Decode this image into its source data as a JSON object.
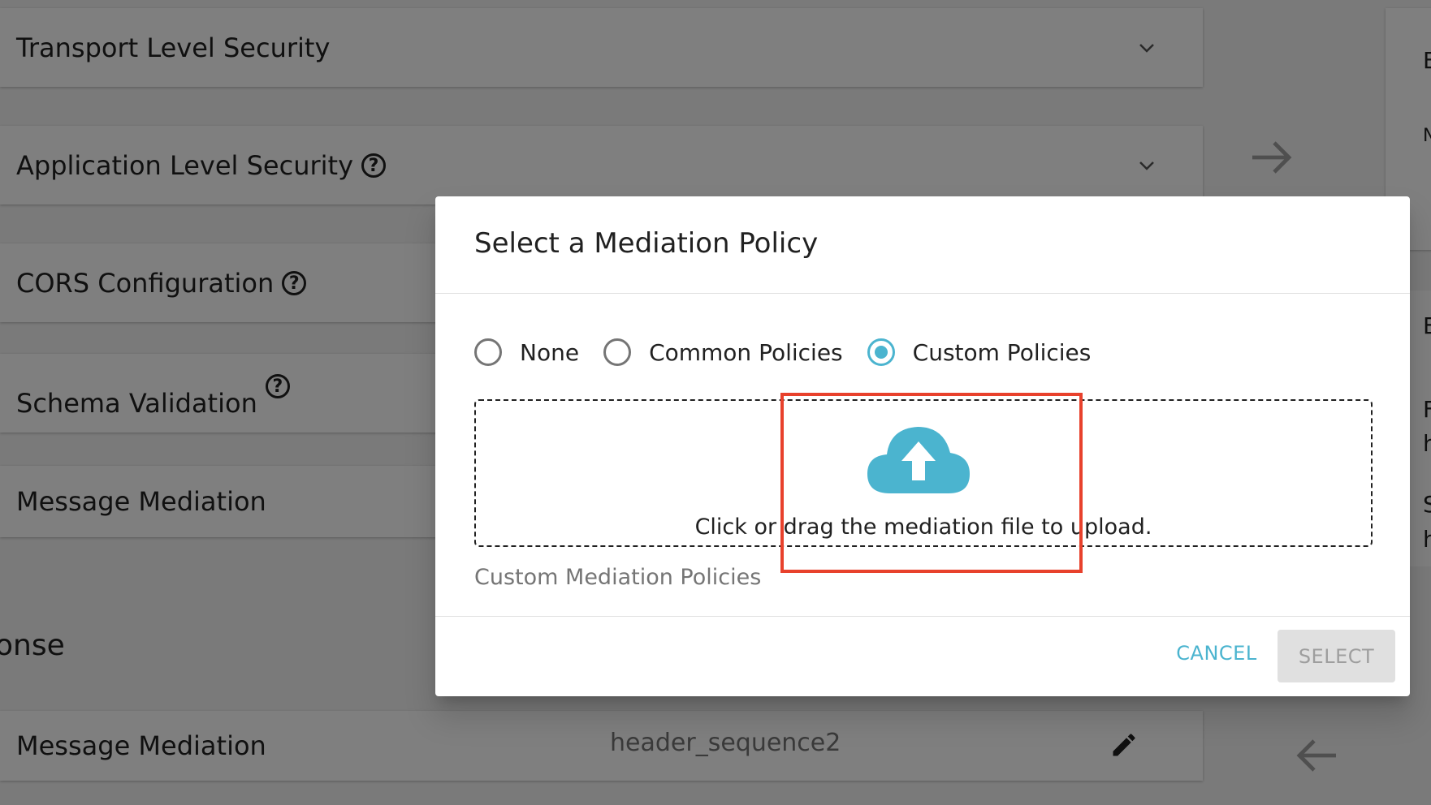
{
  "background": {
    "panels": [
      {
        "title": "Transport Level Security",
        "help": false,
        "chevron": true
      },
      {
        "title": "Application Level Security",
        "help": true,
        "chevron": true
      },
      {
        "title": "CORS Configuration",
        "help": true,
        "chevron": false
      },
      {
        "title": "Schema Validation",
        "help": true,
        "chevron": false
      },
      {
        "title": "Message Mediation",
        "help": false,
        "chevron": false
      }
    ],
    "response_section": {
      "label": "onse",
      "message_mediation": "Message Mediation",
      "selected_sequence": "header_sequence2"
    },
    "help_glyph": "?",
    "right_edge_letters": [
      "E",
      "N",
      "E",
      "F",
      "h",
      "S",
      "h"
    ]
  },
  "dialog": {
    "title": "Select a Mediation Policy",
    "options": [
      {
        "label": "None",
        "checked": false
      },
      {
        "label": "Common Policies",
        "checked": false
      },
      {
        "label": "Custom Policies",
        "checked": true
      }
    ],
    "dropzone_text": "Click or drag the mediation file to upload.",
    "helper_text": "Custom Mediation Policies",
    "cancel_label": "CANCEL",
    "select_label": "SELECT"
  },
  "colors": {
    "accent": "#4bb4cf",
    "highlight": "#e8412c",
    "overlay": "rgba(0,0,0,0.5)"
  },
  "icons": [
    "chevron-down-icon",
    "help-circle-icon",
    "arrow-right-icon",
    "arrow-left-icon",
    "pencil-icon",
    "cloud-upload-icon"
  ]
}
